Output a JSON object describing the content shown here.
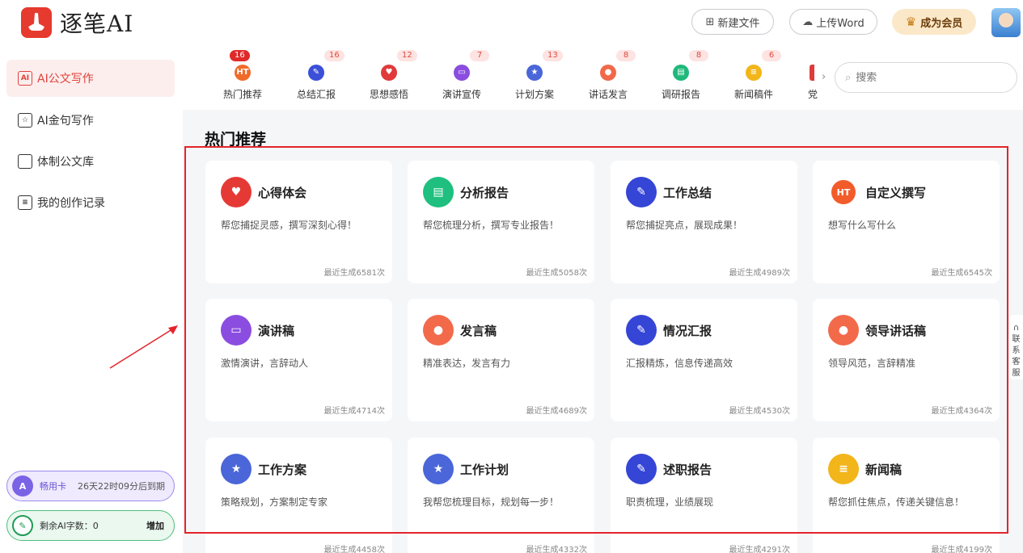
{
  "app": {
    "name": "逐笔AI"
  },
  "header": {
    "new_file": "新建文件",
    "upload_word": "上传Word",
    "vip": "成为会员"
  },
  "sidebar": {
    "items": [
      {
        "label": "AI公文写作",
        "icon": "ai-doc-icon",
        "active": true
      },
      {
        "label": "AI金句写作",
        "icon": "star-doc-icon",
        "active": false
      },
      {
        "label": "体制公文库",
        "icon": "folder-icon",
        "active": false
      },
      {
        "label": "我的创作记录",
        "icon": "record-icon",
        "active": false
      }
    ],
    "vip_card": {
      "icon_text": "A",
      "label": "畅用卡",
      "expiry": "26天22时09分后到期"
    },
    "words": {
      "label": "剩余AI字数：0",
      "action": "增加"
    }
  },
  "categories": [
    {
      "label": "热门推荐",
      "badge": "16",
      "color": "#f06a2a"
    },
    {
      "label": "总结汇报",
      "badge": "16",
      "color": "#3b4fd8"
    },
    {
      "label": "思想感悟",
      "badge": "12",
      "color": "#e03a3a"
    },
    {
      "label": "演讲宣传",
      "badge": "7",
      "color": "#8a4de0"
    },
    {
      "label": "计划方案",
      "badge": "13",
      "color": "#4a66d8"
    },
    {
      "label": "讲话发言",
      "badge": "8",
      "color": "#f06a4a"
    },
    {
      "label": "调研报告",
      "badge": "8",
      "color": "#1fb87a"
    },
    {
      "label": "新闻稿件",
      "badge": "6",
      "color": "#f2b51a"
    },
    {
      "label": "党",
      "badge": "",
      "color": "#e03a3a"
    }
  ],
  "search": {
    "placeholder": "搜索"
  },
  "section_title": "热门推荐",
  "cards": [
    {
      "title": "心得体会",
      "desc": "帮您捕捉灵感，撰写深刻心得！",
      "count": "最近生成6581次",
      "color": "#e53935",
      "icon": "notebook-heart-icon"
    },
    {
      "title": "分析报告",
      "desc": "帮您梳理分析，撰写专业报告！",
      "count": "最近生成5058次",
      "color": "#1fbf7f",
      "icon": "report-icon"
    },
    {
      "title": "工作总结",
      "desc": "帮您捕捉亮点，展现成果！",
      "count": "最近生成4989次",
      "color": "#3545d6",
      "icon": "pen-doc-icon"
    },
    {
      "title": "自定义撰写",
      "desc": "想写什么写什么",
      "count": "最近生成6545次",
      "color": "#f25c2a",
      "icon": "flame-icon"
    },
    {
      "title": "演讲稿",
      "desc": "激情演讲，言辞动人",
      "count": "最近生成4714次",
      "color": "#8a4de0",
      "icon": "podium-icon"
    },
    {
      "title": "发言稿",
      "desc": "精准表达，发言有力",
      "count": "最近生成4689次",
      "color": "#f26a4a",
      "icon": "speaker-icon"
    },
    {
      "title": "情况汇报",
      "desc": "汇报精炼，信息传递高效",
      "count": "最近生成4530次",
      "color": "#3545d6",
      "icon": "pen-doc-icon"
    },
    {
      "title": "领导讲话稿",
      "desc": "领导风范，言辞精准",
      "count": "最近生成4364次",
      "color": "#f26a4a",
      "icon": "speaker-icon"
    },
    {
      "title": "工作方案",
      "desc": "策略规划，方案制定专家",
      "count": "最近生成4458次",
      "color": "#4a66d8",
      "icon": "plan-icon"
    },
    {
      "title": "工作计划",
      "desc": "我帮您梳理目标，规划每一步！",
      "count": "最近生成4332次",
      "color": "#4a66d8",
      "icon": "plan-icon"
    },
    {
      "title": "述职报告",
      "desc": "职责梳理，业绩展现",
      "count": "最近生成4291次",
      "color": "#3545d6",
      "icon": "pen-doc-icon"
    },
    {
      "title": "新闻稿",
      "desc": "帮您抓住焦点，传递关键信息！",
      "count": "最近生成4199次",
      "color": "#f2b51a",
      "icon": "news-icon"
    }
  ],
  "side_tab": "联系客服"
}
